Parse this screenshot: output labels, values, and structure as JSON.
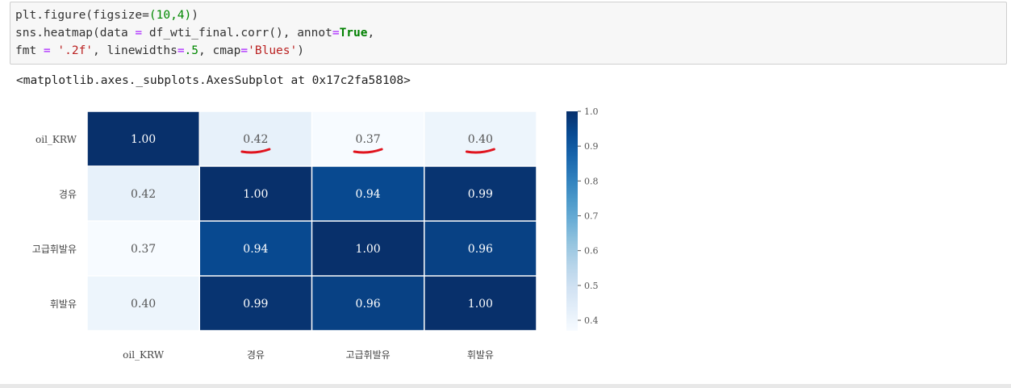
{
  "code": {
    "line1": [
      "plt.figure(figsize=",
      "(10,4)",
      ")"
    ],
    "line2_parts": [
      "sns.heatmap(data ",
      "=",
      " df_wti_final.corr(), annot",
      "=",
      "True",
      ","
    ],
    "line3_parts": [
      "fmt ",
      "=",
      " ",
      "'.2f'",
      ", linewidths",
      "=",
      ".5",
      ", cmap",
      "=",
      "'Blues'",
      ")"
    ]
  },
  "output": {
    "repr": "<matplotlib.axes._subplots.AxesSubplot at 0x17c2fa58108>"
  },
  "chart_data": {
    "type": "heatmap",
    "rows": [
      "oil_KRW",
      "경유",
      "고급휘발유",
      "휘발유"
    ],
    "columns": [
      "oil_KRW",
      "경유",
      "고급휘발유",
      "휘발유"
    ],
    "values": [
      [
        1.0,
        0.42,
        0.37,
        0.4
      ],
      [
        0.42,
        1.0,
        0.94,
        0.99
      ],
      [
        0.37,
        0.94,
        1.0,
        0.96
      ],
      [
        0.4,
        0.99,
        0.96,
        1.0
      ]
    ],
    "annotation_format": ".2f",
    "colormap": "Blues",
    "colorbar": {
      "range": [
        0.37,
        1.0
      ],
      "ticks": [
        0.4,
        0.5,
        0.6,
        0.7,
        0.8,
        0.9,
        1.0
      ],
      "tick_labels": [
        "0.4",
        "0.5",
        "0.6",
        "0.7",
        "0.8",
        "0.9",
        "1.0"
      ]
    },
    "annotation_marks": {
      "color": "#e0141e",
      "underlined_cells": [
        [
          0,
          1
        ],
        [
          0,
          2
        ],
        [
          0,
          3
        ]
      ]
    }
  }
}
